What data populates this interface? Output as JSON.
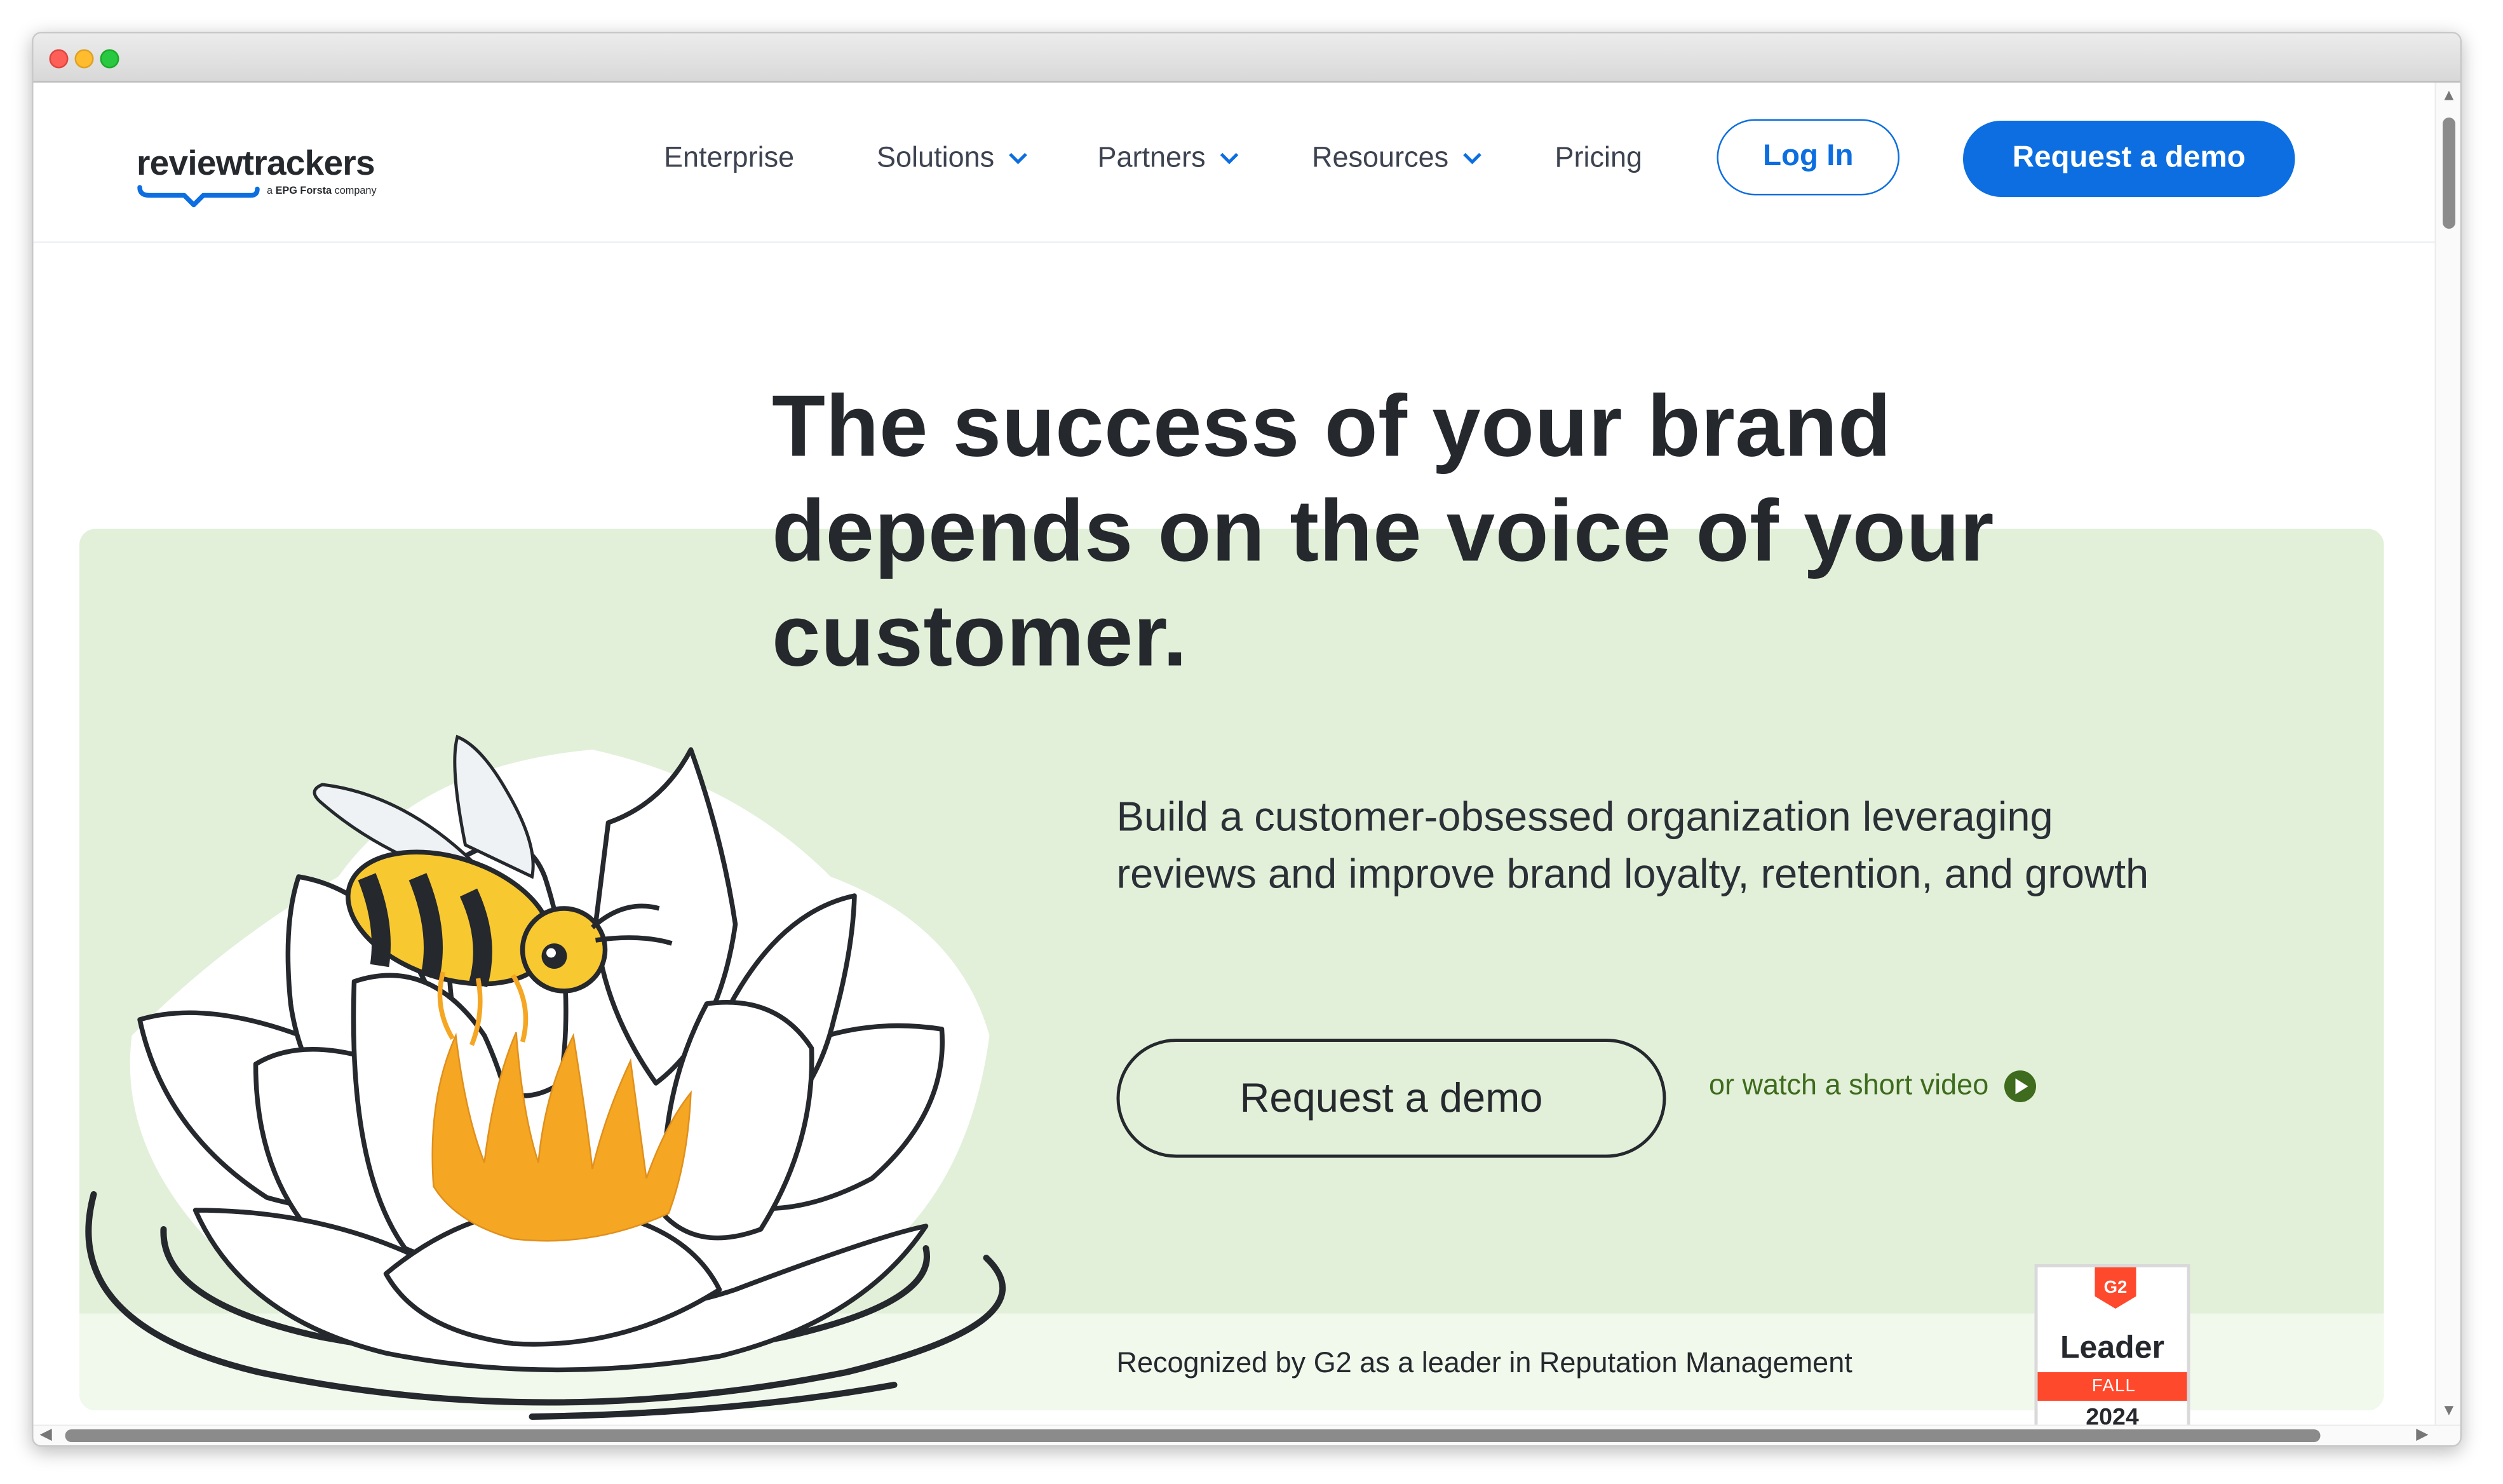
{
  "brand": {
    "name": "reviewtrackers",
    "tagline_prefix": "a",
    "tagline_company": "EPG Forsta",
    "tagline_suffix": "company",
    "primary_color": "#0c6ee0",
    "hero_bg_color": "#e2f0d9"
  },
  "nav": {
    "items": [
      {
        "label": "Enterprise",
        "has_dropdown": false
      },
      {
        "label": "Solutions",
        "has_dropdown": true
      },
      {
        "label": "Partners",
        "has_dropdown": true
      },
      {
        "label": "Resources",
        "has_dropdown": true
      },
      {
        "label": "Pricing",
        "has_dropdown": false
      }
    ],
    "login_label": "Log In",
    "demo_label": "Request a demo"
  },
  "hero": {
    "headline": "The success of your brand depends on the voice of your customer.",
    "subtext": "Build a customer-obsessed organization leveraging reviews and improve brand loyalty, retention, and growth",
    "cta_label": "Request a demo",
    "video_link_label": "or watch a short video",
    "recognition_text": "Recognized by G2 as a leader in Reputation Management",
    "illustration_icon": "bee-on-water-lily-icon"
  },
  "g2_badge": {
    "logo": "G2",
    "title": "Leader",
    "season": "FALL",
    "year": "2024",
    "color": "#ff492c"
  }
}
